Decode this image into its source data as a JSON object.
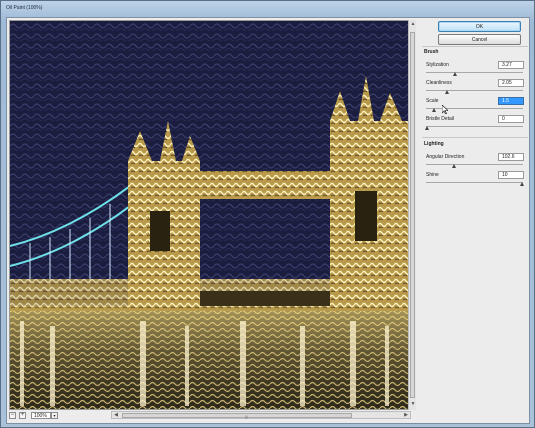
{
  "window": {
    "title": "Oil Paint (100%)"
  },
  "preview": {
    "zoom": "100%",
    "zoom_out_symbol": "−",
    "zoom_in_symbol": "+",
    "dropdown_symbol": "▾"
  },
  "buttons": {
    "ok": "OK",
    "cancel": "Cancel"
  },
  "brush": {
    "heading": "Brush",
    "params": [
      {
        "label": "Stylization",
        "value": "3.27",
        "slider_fraction": 0.29
      },
      {
        "label": "Cleanliness",
        "value": "2.05",
        "slider_fraction": 0.21
      },
      {
        "label": "Scale",
        "value": "1.5",
        "slider_fraction": 0.07
      },
      {
        "label": "Bristle Detail",
        "value": "0",
        "slider_fraction": 0.0
      }
    ]
  },
  "lighting": {
    "heading": "Lighting",
    "params": [
      {
        "label": "Angular Direction",
        "value": "102.6",
        "slider_fraction": 0.28
      },
      {
        "label": "Shine",
        "value": "10",
        "slider_fraction": 1.0
      }
    ]
  },
  "scroll": {
    "up": "▲",
    "down": "▼",
    "left": "◀",
    "right": "▶",
    "grip": "|||"
  }
}
